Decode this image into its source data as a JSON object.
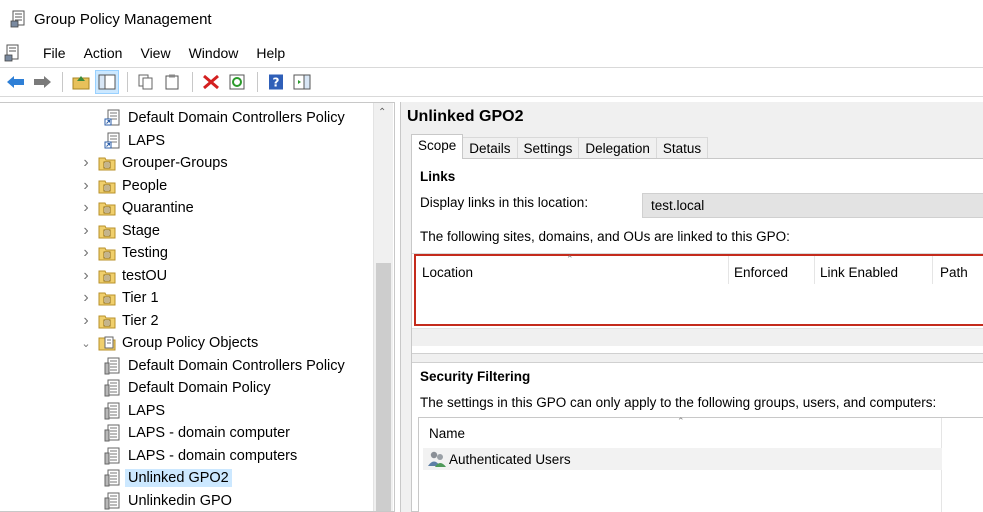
{
  "window": {
    "title": "Group Policy Management"
  },
  "menu": {
    "items": [
      "File",
      "Action",
      "View",
      "Window",
      "Help"
    ]
  },
  "tree": {
    "items": [
      {
        "label": "Default Domain Controllers Policy",
        "kind": "link",
        "indent": 2,
        "expand": ""
      },
      {
        "label": "LAPS",
        "kind": "link",
        "indent": 2,
        "expand": ""
      },
      {
        "label": "Grouper-Groups",
        "kind": "ou",
        "indent": 1,
        "expand": ">"
      },
      {
        "label": "People",
        "kind": "ou",
        "indent": 1,
        "expand": ">"
      },
      {
        "label": "Quarantine",
        "kind": "ou",
        "indent": 1,
        "expand": ">"
      },
      {
        "label": "Stage",
        "kind": "ou",
        "indent": 1,
        "expand": ">"
      },
      {
        "label": "Testing",
        "kind": "ou",
        "indent": 1,
        "expand": ">"
      },
      {
        "label": "testOU",
        "kind": "ou",
        "indent": 1,
        "expand": ">"
      },
      {
        "label": "Tier 1",
        "kind": "ou",
        "indent": 1,
        "expand": ">"
      },
      {
        "label": "Tier 2",
        "kind": "ou",
        "indent": 1,
        "expand": ">"
      },
      {
        "label": "Group Policy Objects",
        "kind": "container",
        "indent": 1,
        "expand": "v"
      },
      {
        "label": "Default Domain Controllers Policy",
        "kind": "gpo",
        "indent": 2,
        "expand": ""
      },
      {
        "label": "Default Domain Policy",
        "kind": "gpo",
        "indent": 2,
        "expand": ""
      },
      {
        "label": "LAPS",
        "kind": "gpo",
        "indent": 2,
        "expand": ""
      },
      {
        "label": "LAPS - domain computer",
        "kind": "gpo",
        "indent": 2,
        "expand": ""
      },
      {
        "label": "LAPS - domain computers",
        "kind": "gpo",
        "indent": 2,
        "expand": ""
      },
      {
        "label": "Unlinked GPO2",
        "kind": "gpo",
        "indent": 2,
        "expand": "",
        "selected": true
      },
      {
        "label": "Unlinkedin GPO",
        "kind": "gpo",
        "indent": 2,
        "expand": ""
      }
    ]
  },
  "detail": {
    "title": "Unlinked GPO2",
    "tabs": [
      "Scope",
      "Details",
      "Settings",
      "Delegation",
      "Status"
    ],
    "active_tab": "Scope",
    "links": {
      "heading": "Links",
      "display_label": "Display links in this location:",
      "location_value": "test.local",
      "description": "The following sites, domains, and OUs are linked to this GPO:",
      "columns": [
        "Location",
        "Enforced",
        "Link Enabled",
        "Path"
      ],
      "rows": []
    },
    "security": {
      "heading": "Security Filtering",
      "description": "The settings in this GPO can only apply to the following groups, users, and computers:",
      "columns": [
        "Name"
      ],
      "rows": [
        "Authenticated Users"
      ]
    }
  },
  "colors": {
    "selection": "#cce8ff",
    "highlight_border": "#c42b1c",
    "pane_bg": "#f0f0f0"
  }
}
